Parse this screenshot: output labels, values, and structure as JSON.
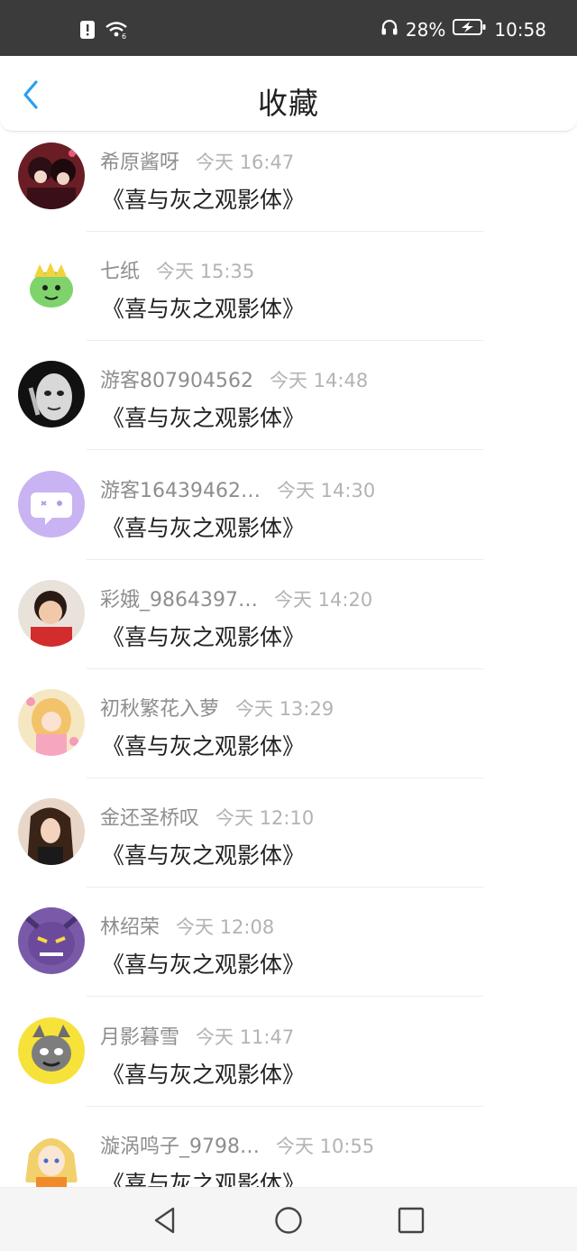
{
  "status_bar": {
    "battery_percent": "28%",
    "time": "10:58",
    "icons": [
      "notification-alert-icon",
      "wifi-icon",
      "headphones-icon",
      "battery-charging-icon"
    ]
  },
  "header": {
    "title": "收藏",
    "back_icon": "chevron-left-icon",
    "accent_color": "#2b9ef2"
  },
  "items": [
    {
      "name": "希原酱呀",
      "time": "今天 16:47",
      "title": "《喜与灰之观影体》"
    },
    {
      "name": "七纸",
      "time": "今天 15:35",
      "title": "《喜与灰之观影体》"
    },
    {
      "name": "游客807904562",
      "time": "今天 14:48",
      "title": "《喜与灰之观影体》"
    },
    {
      "name": "游客16439462…",
      "time": "今天 14:30",
      "title": "《喜与灰之观影体》"
    },
    {
      "name": "彩娥_9864397…",
      "time": "今天 14:20",
      "title": "《喜与灰之观影体》"
    },
    {
      "name": "初秋繁花入萝",
      "time": "今天 13:29",
      "title": "《喜与灰之观影体》"
    },
    {
      "name": "金还圣桥叹",
      "time": "今天 12:10",
      "title": "《喜与灰之观影体》"
    },
    {
      "name": "林绍荣",
      "time": "今天 12:08",
      "title": "《喜与灰之观影体》"
    },
    {
      "name": "月影暮雪",
      "time": "今天 11:47",
      "title": "《喜与灰之观影体》"
    },
    {
      "name": "漩涡鸣子_9798…",
      "time": "今天 10:55",
      "title": "《喜与灰之观影体》"
    }
  ],
  "nav_bar": {
    "icons": [
      "back-triangle-icon",
      "home-circle-icon",
      "recents-square-icon"
    ]
  }
}
